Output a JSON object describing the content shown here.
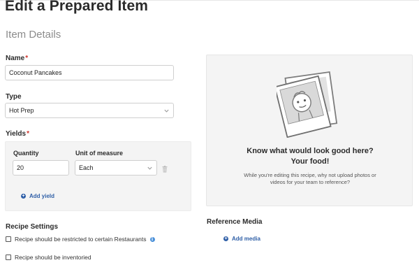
{
  "page": {
    "title": "Edit a Prepared Item",
    "section_title": "Item Details"
  },
  "name_field": {
    "label": "Name",
    "required_marker": "*",
    "value": "Coconut Pancakes"
  },
  "type_field": {
    "label": "Type",
    "value": "Hot Prep"
  },
  "yields": {
    "label": "Yields",
    "required_marker": "*",
    "quantity_label": "Quantity",
    "quantity_value": "20",
    "unit_label": "Unit of measure",
    "unit_value": "Each",
    "add_yield_label": "Add yield"
  },
  "recipe_settings": {
    "heading": "Recipe Settings",
    "options": [
      {
        "label": "Recipe should be restricted to certain Restaurants",
        "checked": false
      },
      {
        "label": "Recipe should be inventoried",
        "checked": false
      }
    ]
  },
  "media_panel": {
    "heading_line1": "Know what would look good here?",
    "heading_line2": "Your food!",
    "desc_line1": "While you're editing this recipe, why not upload photos or",
    "desc_line2": "videos for your team to reference?"
  },
  "reference_media": {
    "heading": "Reference Media",
    "add_media_label": "Add media"
  },
  "colors": {
    "link": "#2f5fa7",
    "required": "#d0342c",
    "panel_bg": "#f4f4f4",
    "info": "#4a90d9"
  },
  "icons": [
    "chevron-down-icon",
    "trash-icon",
    "plus-circle-icon",
    "info-icon",
    "photo-placeholder-icon"
  ]
}
